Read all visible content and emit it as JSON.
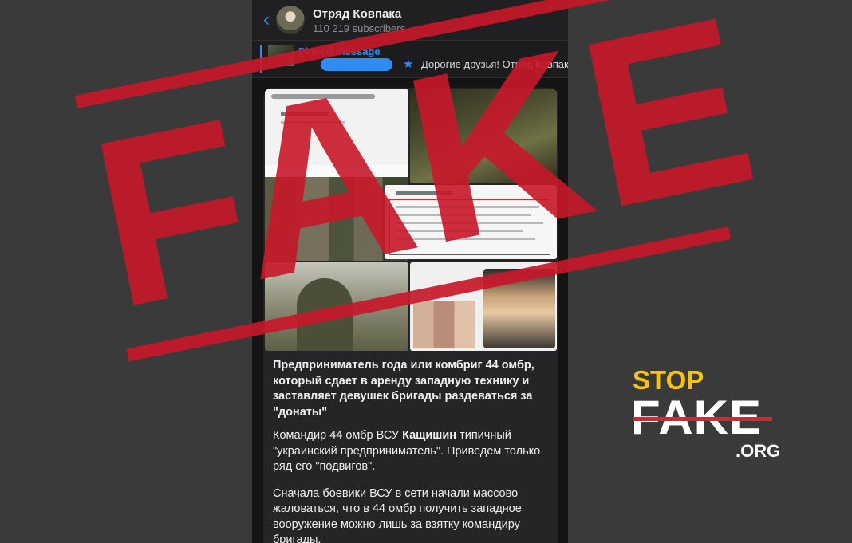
{
  "header": {
    "back_icon": "chevron-left-icon",
    "channel_name": "Отряд Ковпака",
    "subscribers": "110 219 subscribers"
  },
  "pinned": {
    "label": "Pinned message",
    "preview": "Дорогие друзья!   Отряд Ковпака"
  },
  "post": {
    "title": "Предприниматель года или комбриг 44 омбр, который сдает в аренду западную технику и заставляет девушек бригады раздеваться за \"донаты\"",
    "p1_before": "Командир 44 омбр ВСУ ",
    "p1_bold": "Кащишин",
    "p1_after": " типичный \"украинский предприниматель\". Приведем только ряд его \"подвигов\".",
    "p2": "Сначала боевики ВСУ в сети начали массово жаловаться, что в 44 омбр получить западное вооружение можно лишь за взятку командиру бригады."
  },
  "stamp": {
    "text": "FAKE",
    "color": "#c7182a"
  },
  "logo": {
    "line1": "STOP",
    "line2": "FAKE",
    "line3": ".ORG",
    "accent": "#f6c314",
    "strike_color": "#d7262f"
  }
}
